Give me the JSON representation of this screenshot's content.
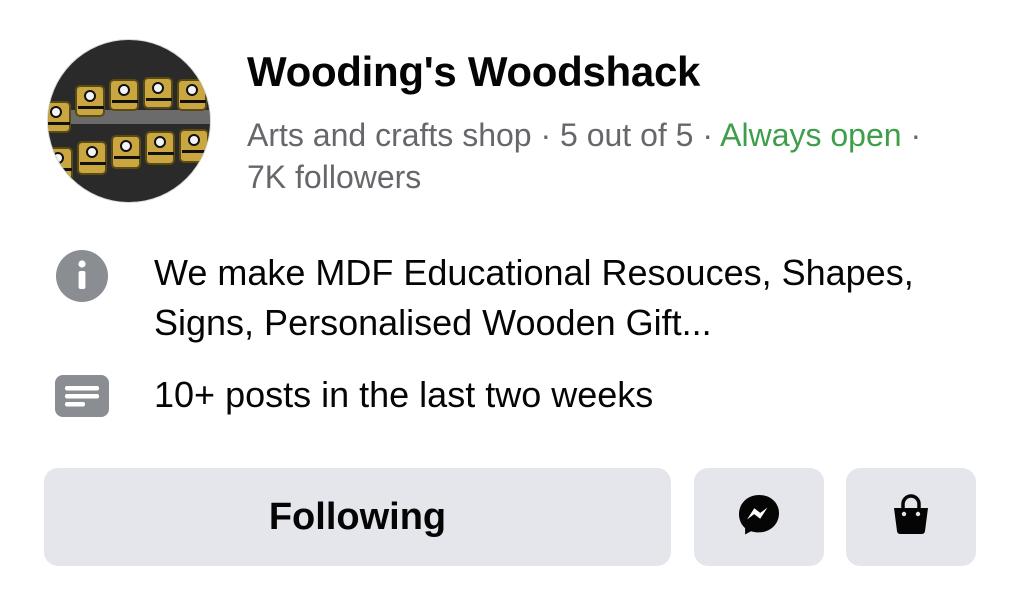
{
  "page": {
    "name": "Wooding's Woodshack",
    "category": "Arts and crafts shop",
    "separator": " · ",
    "rating": "5 out of 5",
    "hours_status": "Always open",
    "followers": "7K followers",
    "status_color": "#3e9e4a"
  },
  "about": {
    "icon": "info-icon",
    "text": "We make MDF Educational Resouces, Shapes, Signs, Personalised Wooden Gift..."
  },
  "activity": {
    "icon": "posts-icon",
    "text": "10+ posts in the last two weeks"
  },
  "actions": {
    "following_label": "Following",
    "messenger_icon": "messenger-icon",
    "shop_icon": "shopping-bag-icon"
  }
}
